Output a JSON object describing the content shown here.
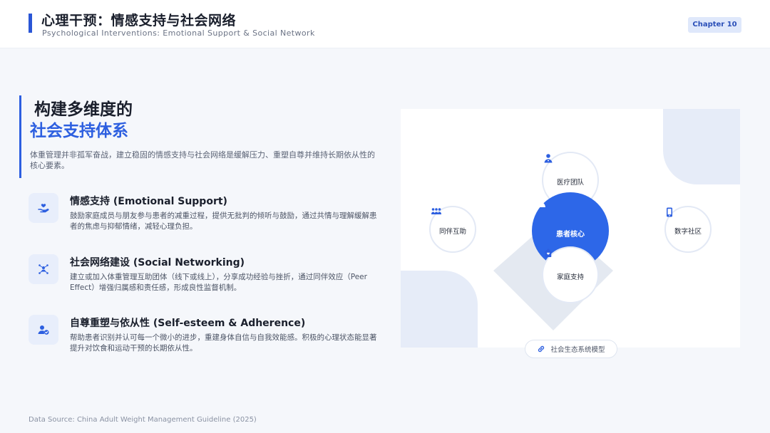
{
  "header": {
    "title": "心理干预：情感支持与社会网络",
    "subtitle": "Psychological Interventions: Emotional Support & Social Network",
    "chapter": "Chapter 10"
  },
  "hero": {
    "line1": "构建多维度的",
    "line2": "社会支持体系",
    "description": "体重管理并非孤军奋战，建立稳固的情感支持与社会网络是缓解压力、重塑自尊并维持长期依从性的核心要素。"
  },
  "features": [
    {
      "icon": "hand-heart-icon",
      "title": "情感支持 (Emotional Support)",
      "description": "鼓励家庭成员与朋友参与患者的减重过程，提供无批判的倾听与鼓励，通过共情与理解缓解患者的焦虑与抑郁情绪，减轻心理负担。"
    },
    {
      "icon": "network-users-icon",
      "title": "社会网络建设 (Social Networking)",
      "description": "建立或加入体重管理互助团体（线下或线上），分享成功经验与挫折，通过同伴效应（Peer Effect）增强归属感和责任感，形成良性监督机制。"
    },
    {
      "icon": "user-check-icon",
      "title": "自尊重塑与依从性 (Self-esteem & Adherence)",
      "description": "帮助患者识别并认可每一个微小的进步，重建身体自信与自我效能感。积极的心理状态能显著提升对饮食和运动干预的长期依从性。"
    }
  ],
  "diagram": {
    "core": {
      "label": "患者核心",
      "icon": "user-icon"
    },
    "nodes": {
      "medical": {
        "label": "医疗团队",
        "icon": "doctor-icon"
      },
      "peer": {
        "label": "同伴互助",
        "icon": "people-group-icon"
      },
      "digital": {
        "label": "数字社区",
        "icon": "mobile-icon"
      },
      "family": {
        "label": "家庭支持",
        "icon": "home-heart-icon"
      }
    },
    "caption": {
      "label": "社会生态系统模型",
      "icon": "link-icon"
    }
  },
  "footer": {
    "source": "Data Source: China Adult Weight Management Guideline (2025)"
  },
  "colors": {
    "accent": "#2d5fe0",
    "core": "#2d67e8",
    "icon_bg": "#e8eefb",
    "background": "#f5f7fb"
  }
}
